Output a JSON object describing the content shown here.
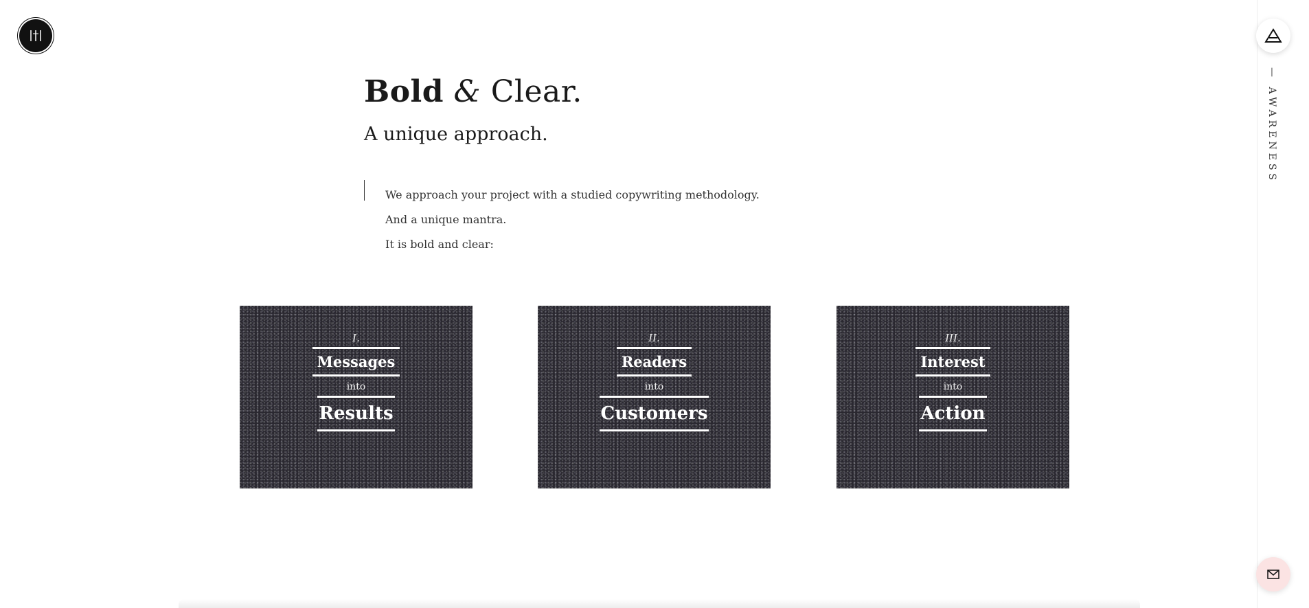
{
  "header": {
    "logo_icon": "monogram-logo-icon",
    "nav_icon": "triangle-menu-icon",
    "side_label": "— AWARENESS"
  },
  "hero": {
    "title_bold": "Bold",
    "title_amp": "&",
    "title_rest": "Clear.",
    "subtitle": "A unique approach."
  },
  "intro": {
    "lines": [
      "We approach your project with a studied copywriting methodology.",
      "And a unique mantra.",
      "It is bold and clear:"
    ]
  },
  "cards": [
    {
      "numeral": "I.",
      "top": "Messages",
      "connector": "into",
      "bottom": "Results"
    },
    {
      "numeral": "II.",
      "top": "Readers",
      "connector": "into",
      "bottom": "Customers"
    },
    {
      "numeral": "III.",
      "top": "Interest",
      "connector": "into",
      "bottom": "Action"
    }
  ],
  "contact": {
    "icon": "mail-icon"
  },
  "colors": {
    "card_bg": "#2a2830",
    "mail_bg": "#fbe3e3",
    "text": "#1a1a1a"
  }
}
